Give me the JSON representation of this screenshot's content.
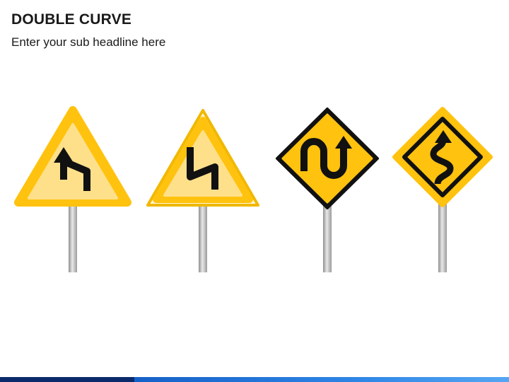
{
  "header": {
    "title": "DOUBLE CURVE",
    "subtitle": "Enter your sub headline here"
  },
  "signs": [
    {
      "name": "triangle-double-curve-sign",
      "shape": "triangle",
      "icon": "zigzag-arrow-icon"
    },
    {
      "name": "outlined-triangle-double-curve-sign",
      "shape": "triangle-outlined",
      "icon": "zigzag-arrow-icon"
    },
    {
      "name": "diamond-winding-road-sign",
      "shape": "diamond",
      "icon": "u-turn-arrow-icon"
    },
    {
      "name": "diamond-double-curve-sign",
      "shape": "diamond-outlined",
      "icon": "s-curve-arrow-icon"
    }
  ],
  "colors": {
    "sign_yellow": "#FFC20E",
    "sign_light_yellow": "#FFE08A",
    "sign_black": "#111111",
    "pole_gray": "#BDBDBD",
    "footer_dark": "#0A2A6B",
    "footer_light": "#2F86E6"
  }
}
